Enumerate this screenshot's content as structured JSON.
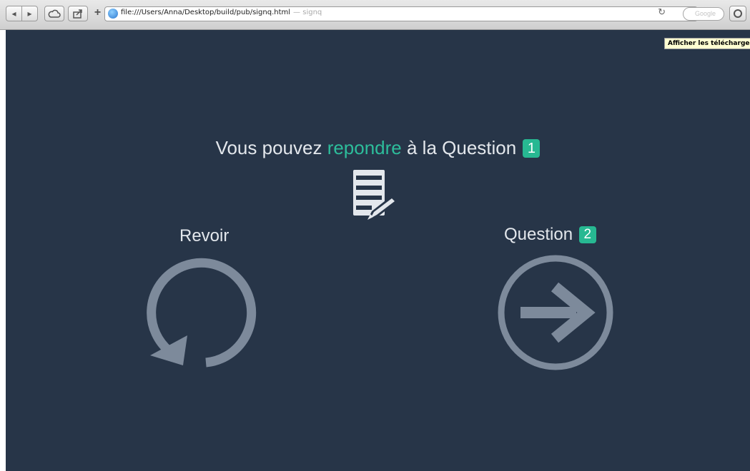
{
  "browser": {
    "url": "file:///Users/Anna/Desktop/build/pub/signq.html",
    "page_title": "signq",
    "search_placeholder": "Google",
    "tooltip": "Afficher les téléchargement"
  },
  "main": {
    "headline_before": "Vous pouvez ",
    "headline_accent": "repondre",
    "headline_after": " à la Question ",
    "current_question": "1",
    "revoir_label": "Revoir",
    "next_label": "Question ",
    "next_question": "2"
  },
  "colors": {
    "background": "#273548",
    "accent": "#2dbd9b",
    "badge": "#27b892",
    "icon": "#7d8a9b"
  },
  "icons": {
    "form": "form-edit-icon",
    "revoir": "refresh-icon",
    "next": "arrow-right-circle-icon"
  }
}
